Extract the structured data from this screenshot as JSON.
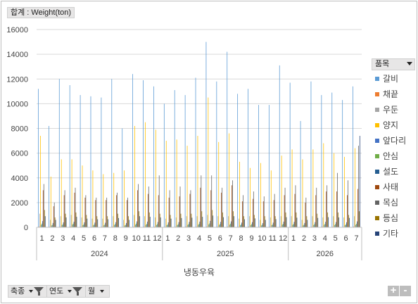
{
  "value_field": {
    "label": "합계 : Weight(ton)"
  },
  "legend": {
    "title": "품목",
    "items": [
      {
        "name": "갈비",
        "color": "#5b9bd5"
      },
      {
        "name": "채끝",
        "color": "#ed7d31"
      },
      {
        "name": "우둔",
        "color": "#a5a5a5"
      },
      {
        "name": "양지",
        "color": "#ffc000"
      },
      {
        "name": "앞다리",
        "color": "#4472c4"
      },
      {
        "name": "안심",
        "color": "#70ad47"
      },
      {
        "name": "설도",
        "color": "#255e91"
      },
      {
        "name": "사태",
        "color": "#9e480e"
      },
      {
        "name": "목심",
        "color": "#636363"
      },
      {
        "name": "등심",
        "color": "#997300"
      },
      {
        "name": "기타",
        "color": "#264478"
      }
    ]
  },
  "axis_title": "냉동우육",
  "filter_buttons": {
    "species": "축종",
    "year": "연도",
    "month": "월"
  },
  "zoom": {
    "plus": "+",
    "minus": "-"
  },
  "chart_data": {
    "type": "bar",
    "ylim": [
      0,
      16000
    ],
    "yticks": [
      0,
      2000,
      4000,
      6000,
      8000,
      10000,
      12000,
      14000,
      16000
    ],
    "grid": true,
    "legend_position": "right",
    "groups": [
      {
        "label": "2024",
        "months": [
          "1",
          "2",
          "3",
          "4",
          "5",
          "6",
          "7",
          "8",
          "9",
          "10",
          "11",
          "12"
        ]
      },
      {
        "label": "2025",
        "months": [
          "1",
          "2",
          "3",
          "4",
          "5",
          "6",
          "7",
          "8",
          "9",
          "10",
          "11",
          "12"
        ]
      },
      {
        "label": "2026",
        "months": [
          "1",
          "2",
          "3",
          "4",
          "5",
          "6",
          "7"
        ]
      }
    ],
    "series": [
      {
        "name": "갈비",
        "values": [
          11200,
          8200,
          12000,
          11500,
          10700,
          10600,
          10500,
          12000,
          8000,
          12400,
          11900,
          11400,
          10000,
          11100,
          10700,
          12100,
          15000,
          11800,
          14200,
          10800,
          11200,
          9900,
          9900,
          13100,
          11700,
          8600,
          11800,
          10700,
          10900,
          10300,
          11400
        ]
      },
      {
        "name": "채끝",
        "values": [
          60,
          40,
          50,
          60,
          50,
          40,
          50,
          60,
          40,
          50,
          50,
          50,
          40,
          50,
          60,
          50,
          60,
          50,
          60,
          40,
          60,
          40,
          50,
          60,
          50,
          40,
          50,
          60,
          50,
          40,
          60
        ]
      },
      {
        "name": "우둔",
        "values": [
          1100,
          600,
          900,
          1000,
          800,
          700,
          700,
          900,
          600,
          1000,
          900,
          800,
          700,
          800,
          900,
          900,
          1000,
          900,
          900,
          700,
          900,
          600,
          800,
          900,
          900,
          600,
          900,
          800,
          900,
          800,
          900
        ]
      },
      {
        "name": "양지",
        "values": [
          7400,
          4100,
          5500,
          5500,
          5000,
          4600,
          4300,
          4400,
          4600,
          8200,
          8500,
          7900,
          7000,
          7100,
          6600,
          7400,
          10500,
          6900,
          7600,
          5300,
          4800,
          5200,
          4600,
          5800,
          6300,
          5500,
          6300,
          6800,
          6000,
          5700,
          6400
        ]
      },
      {
        "name": "앞다리",
        "values": [
          200,
          150,
          180,
          220,
          170,
          160,
          160,
          190,
          150,
          210,
          200,
          180,
          170,
          180,
          190,
          200,
          230,
          190,
          210,
          160,
          180,
          150,
          170,
          200,
          190,
          150,
          180,
          190,
          180,
          170,
          200
        ]
      },
      {
        "name": "안심",
        "values": [
          300,
          200,
          250,
          300,
          240,
          230,
          220,
          260,
          200,
          300,
          280,
          260,
          240,
          250,
          270,
          290,
          320,
          270,
          300,
          230,
          260,
          210,
          230,
          280,
          270,
          210,
          260,
          280,
          260,
          250,
          290
        ]
      },
      {
        "name": "설도",
        "values": [
          500,
          350,
          400,
          450,
          400,
          380,
          370,
          420,
          350,
          480,
          460,
          430,
          400,
          420,
          440,
          460,
          520,
          440,
          480,
          380,
          420,
          340,
          380,
          460,
          440,
          350,
          420,
          450,
          430,
          410,
          480
        ]
      },
      {
        "name": "사태",
        "values": [
          3000,
          1700,
          2600,
          2800,
          2400,
          2200,
          2200,
          2600,
          2200,
          3000,
          2700,
          2600,
          2400,
          2500,
          2700,
          3200,
          3000,
          2800,
          3400,
          2100,
          2300,
          2100,
          2200,
          2600,
          2700,
          2000,
          2600,
          2900,
          2900,
          2600,
          3100
        ]
      },
      {
        "name": "목심",
        "values": [
          3500,
          2000,
          3000,
          3200,
          2600,
          2400,
          2400,
          2800,
          2400,
          3500,
          3300,
          4200,
          3000,
          3300,
          3000,
          4200,
          4200,
          3200,
          3800,
          2600,
          2900,
          2500,
          2700,
          3200,
          3400,
          2400,
          3200,
          3400,
          4400,
          3800,
          6600
        ]
      },
      {
        "name": "등심",
        "values": [
          1400,
          800,
          1100,
          1200,
          1000,
          900,
          900,
          1100,
          900,
          1300,
          1200,
          1100,
          1000,
          1100,
          1100,
          1300,
          1400,
          1200,
          1300,
          900,
          1000,
          900,
          900,
          1200,
          1200,
          900,
          1100,
          1200,
          1200,
          1000,
          1300
        ]
      },
      {
        "name": "기타",
        "values": [
          900,
          600,
          800,
          850,
          700,
          650,
          650,
          750,
          600,
          900,
          850,
          800,
          700,
          750,
          780,
          850,
          950,
          820,
          900,
          650,
          720,
          600,
          660,
          820,
          780,
          600,
          760,
          820,
          800,
          760,
          7400
        ]
      }
    ]
  }
}
